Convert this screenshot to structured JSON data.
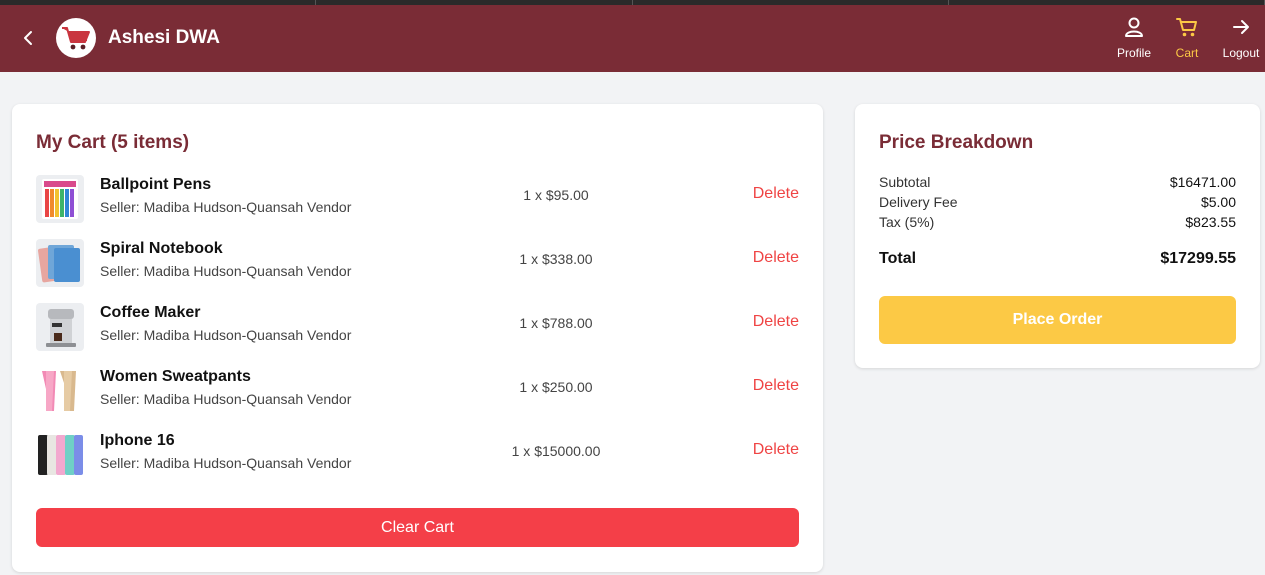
{
  "header": {
    "brand": "Ashesi DWA",
    "nav": {
      "profile": "Profile",
      "cart": "Cart",
      "logout": "Logout"
    },
    "colors": {
      "bar": "#7a2c36",
      "active": "#fcc945"
    }
  },
  "cart": {
    "title": "My Cart (5 items)",
    "delete_label": "Delete",
    "items": [
      {
        "name": "Ballpoint Pens",
        "seller": "Seller: Madiba Hudson-Quansah Vendor",
        "qty": "1 x $95.00",
        "delete": "Delete"
      },
      {
        "name": "Spiral Notebook",
        "seller": "Seller: Madiba Hudson-Quansah Vendor",
        "qty": "1 x $338.00",
        "delete": "Delete"
      },
      {
        "name": "Coffee Maker",
        "seller": "Seller: Madiba Hudson-Quansah Vendor",
        "qty": "1 x $788.00",
        "delete": "Delete"
      },
      {
        "name": "Women Sweatpants",
        "seller": "Seller: Madiba Hudson-Quansah Vendor",
        "qty": "1 x $250.00",
        "delete": "Delete"
      },
      {
        "name": "Iphone 16",
        "seller": "Seller: Madiba Hudson-Quansah Vendor",
        "qty": "1 x $15000.00",
        "delete": "Delete"
      }
    ],
    "clear_label": "Clear Cart"
  },
  "price": {
    "title": "Price Breakdown",
    "subtotal_label": "Subtotal",
    "subtotal": "$16471.00",
    "delivery_label": "Delivery Fee",
    "delivery": "$5.00",
    "tax_label": "Tax (5%)",
    "tax": "$823.55",
    "total_label": "Total",
    "total": "$17299.55",
    "order_label": "Place Order"
  }
}
